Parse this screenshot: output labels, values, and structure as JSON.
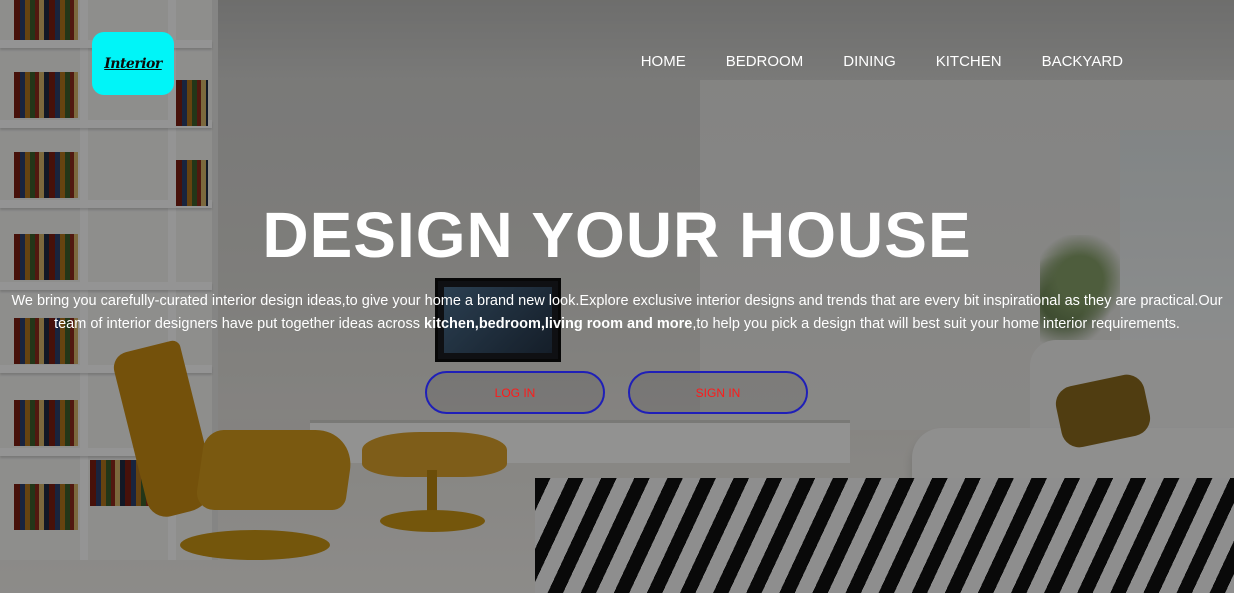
{
  "logo": {
    "text": "Interior",
    "background": "#00f5f8"
  },
  "nav": {
    "items": [
      {
        "label": "HOME"
      },
      {
        "label": "BEDROOM"
      },
      {
        "label": "DINING"
      },
      {
        "label": "KITCHEN"
      },
      {
        "label": "BACKYARD"
      }
    ]
  },
  "hero": {
    "title": "DESIGN YOUR HOUSE",
    "intro_part1": "We bring you carefully-curated interior design ideas,to give your home a brand new look.Explore exclusive interior designs and trends that are every bit inspirational as they are practical.Our team of interior designers have put together ideas across ",
    "intro_bold": "kitchen,bedroom,living room and more",
    "intro_part2": ",to help you pick a design that will best suit your home interior requirements."
  },
  "buttons": {
    "login_label": "LOG IN",
    "signin_label": "SIGN IN"
  },
  "colors": {
    "button_border": "#1f1fb8",
    "button_text": "#ff1a1a",
    "overlay": "rgba(0,0,0,0.42)"
  }
}
